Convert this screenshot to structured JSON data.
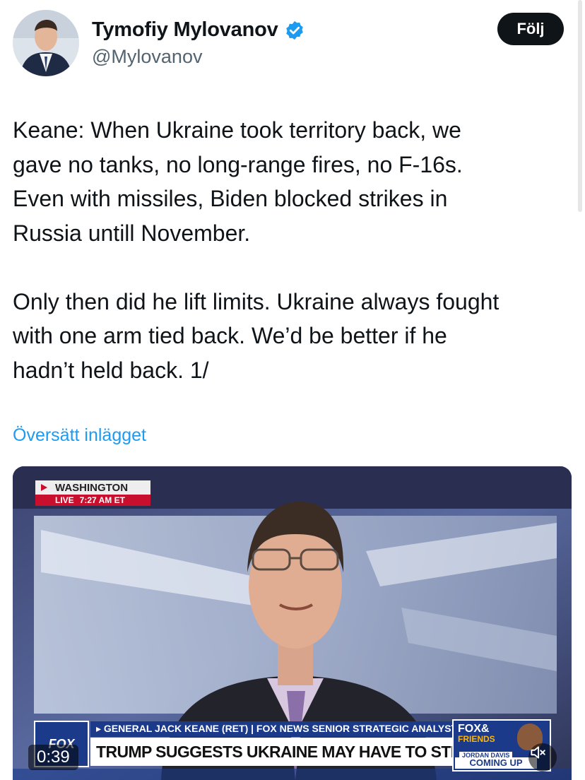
{
  "author": {
    "name": "Tymofiy Mylovanov",
    "handle": "@Mylovanov",
    "verified_color": "#1d9bf0"
  },
  "follow_label": "Följ",
  "tweet": {
    "text": "Keane: When Ukraine took territory back, we\ngave no tanks, no long-range fires, no F-16s.\nEven with missiles, Biden blocked strikes in\nRussia untill November.\n\nOnly then did he lift limits. Ukraine always fought\nwith one arm tied back. We’d be better if he\nhadn’t held back. 1/",
    "translate_label": "Översätt inlägget"
  },
  "video": {
    "location": "WASHINGTON",
    "live_label": "LIVE",
    "live_time": "7:27 AM ET",
    "network_logo": "FOX",
    "chyron_top": "▸ GENERAL JACK KEANE (RET) | FOX NEWS SENIOR STRATEGIC ANALYST",
    "chyron_main": "TRUMP SUGGESTS UKRAINE MAY HAVE TO STRIKE RUSSIA",
    "show_logo": "FOX&",
    "show_logo_sub": "FRIENDS",
    "host_name": "JORDAN DAVIS",
    "coming_up": "COMING UP",
    "timestamp": "0:39"
  },
  "colors": {
    "accent": "#1d9bf0",
    "fox_blue": "#1b3a8a",
    "live_red": "#c8102e"
  }
}
